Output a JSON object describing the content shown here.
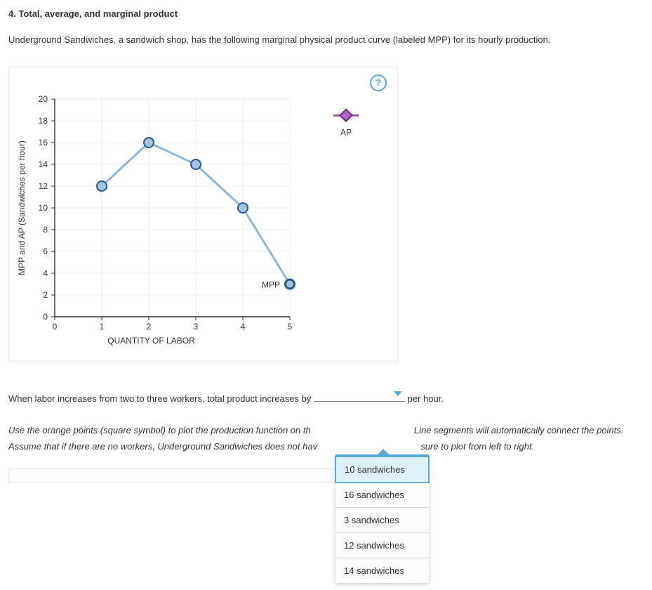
{
  "title": "4. Total, average, and marginal product",
  "intro_prefix": "Underground Sandwiches, a sandwich shop, has the following marginal physical product curve (labeled ",
  "intro_label": "MPP",
  "intro_suffix": ") for its hourly production.",
  "help_label": "?",
  "chart_data": {
    "type": "line",
    "title": "",
    "xlabel": "QUANTITY OF LABOR",
    "ylabel": "MPP and AP (Sandwiches per hour)",
    "xlim": [
      0,
      5
    ],
    "ylim": [
      0,
      20
    ],
    "xticks": [
      0,
      1,
      2,
      3,
      4,
      5
    ],
    "yticks": [
      0,
      2,
      4,
      6,
      8,
      10,
      12,
      14,
      16,
      18,
      20
    ],
    "series": [
      {
        "name": "MPP",
        "x": [
          1,
          2,
          3,
          4,
          5
        ],
        "values": [
          12,
          16,
          14,
          10,
          3
        ]
      }
    ],
    "legend": [
      "AP"
    ],
    "legend_marker": "diamond"
  },
  "question": {
    "prefix": "When labor increases from two to three workers, total product increases by ",
    "suffix": " per hour."
  },
  "dropdown": {
    "options": [
      "10 sandwiches",
      "16 sandwiches",
      "3 sandwiches",
      "12 sandwiches",
      "14 sandwiches"
    ],
    "selected_index": 0
  },
  "instructions": {
    "line1_a": "Use the orange points (square symbol) to plot the production function on th",
    "line1_b": "Line segments will automatically connect the points.",
    "line2_a": "Assume that if there are no workers, Underground Sandwiches does not hav",
    "line2_b": "sure to plot from left to right."
  }
}
